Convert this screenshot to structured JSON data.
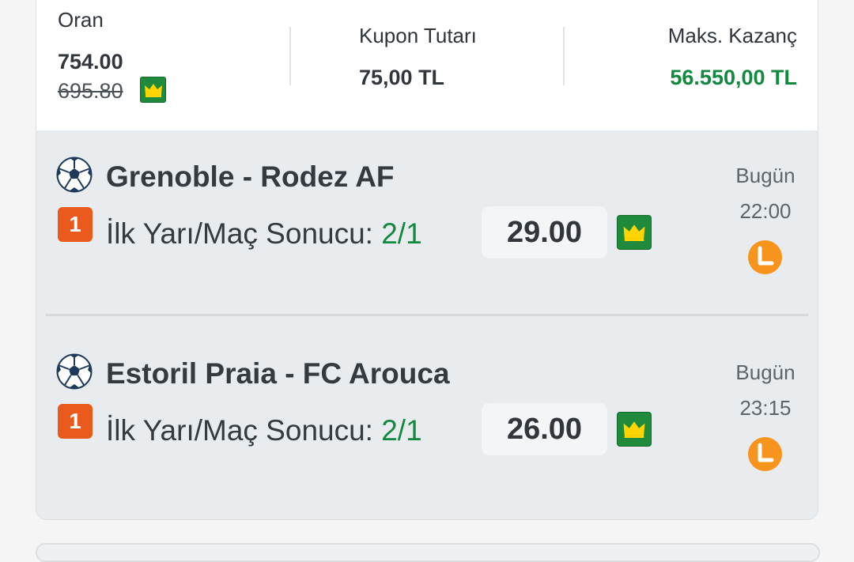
{
  "summary": {
    "oran_label": "Oran",
    "oran_value": "754.00",
    "oran_old": "695.80",
    "kupon_label": "Kupon Tutarı",
    "kupon_value": "75,00 TL",
    "kazanc_label": "Maks. Kazanç",
    "kazanc_value": "56.550,00 TL"
  },
  "matches": [
    {
      "title": "Grenoble - Rodez AF",
      "badge": "1",
      "market": "İlk Yarı/Maç Sonucu: ",
      "pick": "2/1",
      "odds": "29.00",
      "day": "Bugün",
      "time": "22:00"
    },
    {
      "title": "Estoril Praia - FC Arouca",
      "badge": "1",
      "market": "İlk Yarı/Maç Sonucu: ",
      "pick": "2/1",
      "odds": "26.00",
      "day": "Bugün",
      "time": "23:15"
    }
  ],
  "icons": {
    "sport": "soccer-ball-icon",
    "boost": "crown-icon",
    "live": "clock-icon"
  },
  "colors": {
    "green": "#13893f",
    "badge_orange": "#ea5a1c",
    "clock_orange": "#f7941d",
    "crown_green": "#1f8a3c",
    "crown_gold": "#ffd400"
  }
}
